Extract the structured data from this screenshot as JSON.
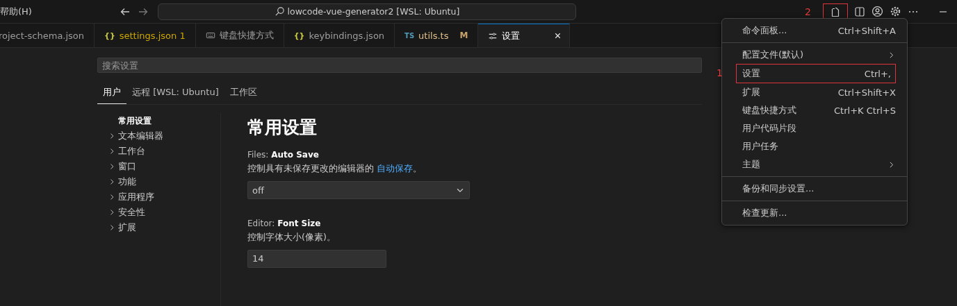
{
  "title_bar": {
    "menu": "帮助(H)",
    "command_center": "lowcode-vue-generator2 [WSL: Ubuntu]"
  },
  "tabs": [
    {
      "kind": "plain",
      "label": "roject-schema.json",
      "selected": false,
      "modified": false
    },
    {
      "kind": "json",
      "icon_text": "{}",
      "label": "settings.json 1",
      "selected": false,
      "modified": true
    },
    {
      "kind": "keyboard",
      "label": "键盘快捷方式",
      "selected": false,
      "modified": false
    },
    {
      "kind": "json",
      "icon_text": "{}",
      "label": "keybindings.json",
      "selected": false,
      "modified": false
    },
    {
      "kind": "typescript",
      "icon_text": "TS",
      "label": "utils.ts",
      "badge": "M",
      "selected": false,
      "modified": true
    },
    {
      "kind": "settings",
      "label": "设置",
      "selected": true,
      "modified": false
    }
  ],
  "settings": {
    "search": {
      "placeholder": "搜索设置"
    },
    "scopes": [
      {
        "label": "用户",
        "selected": true
      },
      {
        "label": "远程 [WSL: Ubuntu]",
        "selected": false
      },
      {
        "label": "工作区",
        "selected": false
      }
    ],
    "toc": [
      {
        "label": "常用设置",
        "selected": true,
        "expandable": false
      },
      {
        "label": "文本编辑器",
        "selected": false,
        "expandable": true
      },
      {
        "label": "工作台",
        "selected": false,
        "expandable": true
      },
      {
        "label": "窗口",
        "selected": false,
        "expandable": true
      },
      {
        "label": "功能",
        "selected": false,
        "expandable": true
      },
      {
        "label": "应用程序",
        "selected": false,
        "expandable": true
      },
      {
        "label": "安全性",
        "selected": false,
        "expandable": true
      },
      {
        "label": "扩展",
        "selected": false,
        "expandable": true
      }
    ],
    "heading": "常用设置",
    "items": [
      {
        "kind": "dropdown",
        "category": "Files: ",
        "name": "Auto Save",
        "description": "控制具有未保存更改的编辑器的 ",
        "link": "自动保存",
        "after": "。",
        "value": "off"
      },
      {
        "kind": "text",
        "category": "Editor: ",
        "name": "Font Size",
        "description": "控制字体大小(像素)。",
        "value": "14"
      }
    ]
  },
  "menu": [
    {
      "kind": "item",
      "label": "命令面板...",
      "shortcut": "Ctrl+Shift+A",
      "submenu": false,
      "highlighted": false
    },
    {
      "kind": "separator"
    },
    {
      "kind": "item",
      "label": "配置文件(默认)",
      "submenu": true,
      "highlighted": false
    },
    {
      "kind": "item",
      "label": "设置",
      "shortcut": "Ctrl+,",
      "submenu": false,
      "highlighted": true
    },
    {
      "kind": "item",
      "label": "扩展",
      "shortcut": "Ctrl+Shift+X",
      "submenu": false,
      "highlighted": false
    },
    {
      "kind": "item",
      "label": "键盘快捷方式",
      "shortcut": "Ctrl+K Ctrl+S",
      "submenu": false,
      "highlighted": false
    },
    {
      "kind": "item",
      "label": "用户代码片段",
      "submenu": false,
      "highlighted": false
    },
    {
      "kind": "item",
      "label": "用户任务",
      "submenu": false,
      "highlighted": false
    },
    {
      "kind": "item",
      "label": "主题",
      "submenu": true,
      "highlighted": false
    },
    {
      "kind": "separator"
    },
    {
      "kind": "item",
      "label": "备份和同步设置...",
      "submenu": false,
      "highlighted": false
    },
    {
      "kind": "separator"
    },
    {
      "kind": "item",
      "label": "检查更新...",
      "submenu": false,
      "highlighted": false
    }
  ],
  "annotations": {
    "menu_item": "1",
    "toolbar_icon": "2"
  }
}
